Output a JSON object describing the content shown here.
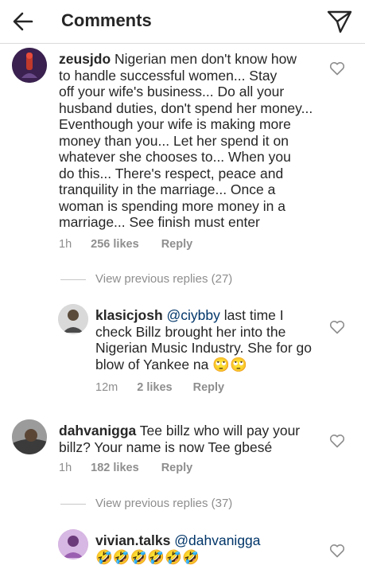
{
  "header": {
    "title": "Comments",
    "back_icon": "arrow-left-icon",
    "send_icon": "paper-plane-icon"
  },
  "comments": [
    {
      "username": "zeusjdo",
      "lines": [
        " Nigerian men don't know how",
        "to handle successful women... Stay",
        "off your wife's business... Do all your",
        "husband duties, don't spend her money...",
        "Eventhough your wife is making more",
        "money than you... Let her spend it on",
        "whatever she chooses to... When you",
        "do this... There's respect, peace and",
        "tranquility in the marriage... Once a",
        "woman is spending more money in a",
        "marriage... See finish must enter"
      ],
      "time": "1h",
      "likes": "256 likes",
      "reply": "Reply"
    },
    {
      "username": "klasicjosh",
      "mention": "@ciybby",
      "lines": [
        " last time I",
        "check Billz brought her into the",
        "Nigerian Music Industry. She for go",
        "blow of Yankee na 🙄🙄"
      ],
      "time": "12m",
      "likes": "2 likes",
      "reply": "Reply"
    },
    {
      "username": "dahvanigga",
      "lines": [
        " Tee billz who will pay your",
        "billz? Your name is now Tee gbesé"
      ],
      "time": "1h",
      "likes": "182 likes",
      "reply": "Reply"
    },
    {
      "username": "vivian.talks",
      "mention": "@dahvanigga",
      "lines": [
        "",
        "🤣🤣🤣🤣🤣🤣"
      ]
    }
  ],
  "view_previous": [
    {
      "label": "View previous replies (27)"
    },
    {
      "label": "View previous replies (37)"
    }
  ],
  "colors": {
    "text": "#262626",
    "muted": "#8e8e8e",
    "mention": "#003569",
    "divider": "#dbdbdb"
  }
}
